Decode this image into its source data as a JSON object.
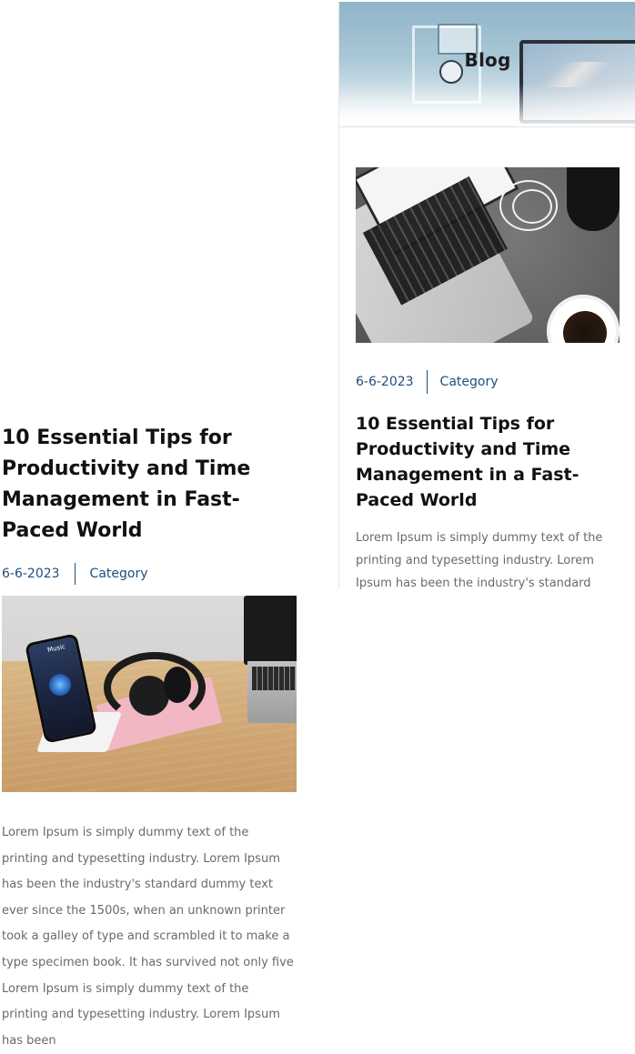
{
  "preview": {
    "hero_title": "Blog",
    "post": {
      "image_alt": "laptop-and-coffee-photo",
      "date": "6-6-2023",
      "category": "Category",
      "title": "10 Essential Tips for Productivity and Time Management in a Fast-Paced World",
      "excerpt": "Lorem Ipsum is simply dummy text of the printing and typesetting industry. Lorem Ipsum has been the industry's standard"
    }
  },
  "article": {
    "title": "10 Essential Tips for Productivity and Time Management in Fast-Paced World",
    "date": "6-6-2023",
    "category": "Category",
    "image_alt": "phone-headphones-desk-photo",
    "phone_screen_label": "Music",
    "body": "Lorem Ipsum is simply dummy text of the printing and typesetting industry. Lorem Ipsum has been the industry's standard dummy text ever since the 1500s, when an unknown printer took a galley of type and scrambled it to make a type specimen book. It has survived not only five Lorem Ipsum is simply dummy text of the printing and typesetting industry. Lorem Ipsum has been"
  },
  "colors": {
    "meta_accent": "#1f4e79",
    "body_text": "#6a6a6a",
    "title_text": "#111111"
  }
}
